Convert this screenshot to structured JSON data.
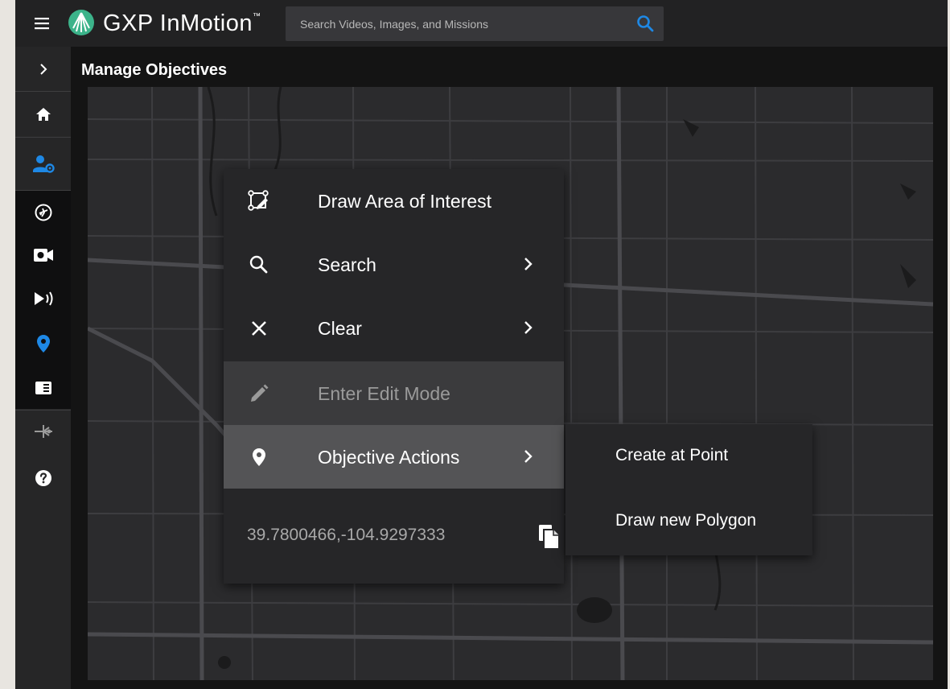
{
  "app": {
    "brand": "GXP InMotion",
    "trademark": "™"
  },
  "search": {
    "placeholder": "Search Videos, Images, and Missions"
  },
  "page": {
    "title": "Manage Objectives"
  },
  "sidebar": {
    "items": [
      {
        "icon": "chevron-right-icon"
      },
      {
        "icon": "home-icon"
      },
      {
        "icon": "user-settings-icon",
        "active": true
      },
      {
        "icon": "flight-icon"
      },
      {
        "icon": "video-camera-icon"
      },
      {
        "icon": "stream-icon"
      },
      {
        "icon": "map-marker-icon",
        "active": true
      },
      {
        "icon": "panel-icon"
      },
      {
        "icon": "network-icon"
      },
      {
        "icon": "help-icon"
      }
    ]
  },
  "context_menu": {
    "items": [
      {
        "label": "Draw Area of Interest",
        "icon": "draw-area-icon",
        "submenu": false
      },
      {
        "label": "Search",
        "icon": "search-icon",
        "submenu": true
      },
      {
        "label": "Clear",
        "icon": "close-icon",
        "submenu": true
      },
      {
        "label": "Enter Edit Mode",
        "icon": "pencil-icon",
        "submenu": false,
        "disabled": true
      },
      {
        "label": "Objective Actions",
        "icon": "map-marker-icon",
        "submenu": true,
        "highlighted": true
      }
    ],
    "coordinates": "39.7800466,-104.9297333"
  },
  "submenu": {
    "items": [
      {
        "label": "Create at Point"
      },
      {
        "label": "Draw new Polygon"
      }
    ]
  },
  "colors": {
    "accent": "#1e88e5",
    "topbar": "#222223",
    "menu_bg": "#262628",
    "highlight": "#545456",
    "map_bg": "#2b2b2d"
  }
}
